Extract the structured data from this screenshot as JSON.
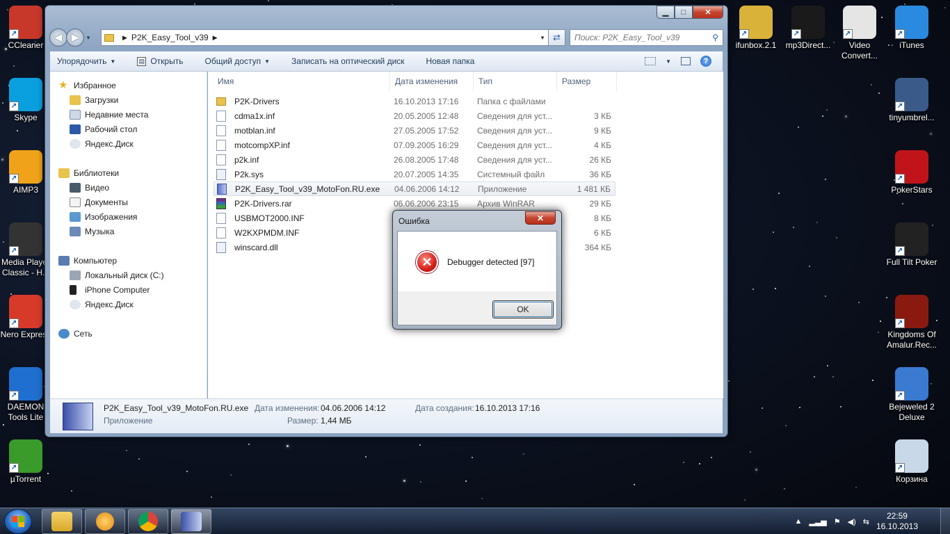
{
  "desktop": {
    "left_icons": [
      {
        "label": "CCleaner",
        "icon": "ccleaner-icon",
        "color": "#c8382a"
      },
      {
        "label": "Skype",
        "icon": "skype-icon",
        "color": "#0aa0e0"
      },
      {
        "label": "AIMP3",
        "icon": "aimp-icon",
        "color": "#f0a21a"
      },
      {
        "label": "Media Player Classic - H...",
        "icon": "media-player-classic-icon",
        "color": "#333333"
      },
      {
        "label": "Nero Express",
        "icon": "nero-icon",
        "color": "#d83a2a"
      },
      {
        "label": "DAEMON Tools Lite",
        "icon": "daemon-tools-icon",
        "color": "#1f6fd0"
      },
      {
        "label": "µTorrent",
        "icon": "utorrent-icon",
        "color": "#3a9a2a"
      }
    ],
    "top_icons": [
      {
        "label": "ifunbox.2.1",
        "icon": "archive-folder-icon",
        "color": "#d9b23a"
      },
      {
        "label": "mp3Direct...",
        "icon": "mp3directcut-icon",
        "color": "#1a1a1a"
      },
      {
        "label": "Video Convert...",
        "icon": "video-converter-icon",
        "color": "#e5e5e5"
      },
      {
        "label": "iTunes",
        "icon": "itunes-icon",
        "color": "#2a8ae0"
      }
    ],
    "right_icons": [
      {
        "label": "tinyumbrel...",
        "icon": "tinyumbrella-icon",
        "color": "#3a5a8a"
      },
      {
        "label": "PokerStars",
        "icon": "pokerstars-icon",
        "color": "#c0141a"
      },
      {
        "label": "Full Tilt Poker",
        "icon": "full-tilt-poker-icon",
        "color": "#222222"
      },
      {
        "label": "Kingdoms Of Amalur.Rec...",
        "icon": "kingdoms-of-amalur-icon",
        "color": "#8a1a10"
      },
      {
        "label": "Bejeweled 2 Deluxe",
        "icon": "bejeweled-icon",
        "color": "#3a7ad0"
      },
      {
        "label": "Корзина",
        "icon": "recycle-bin-icon",
        "color": "#c8d8e8"
      }
    ]
  },
  "explorer": {
    "path": "P2K_Easy_Tool_v39",
    "search_placeholder": "Поиск: P2K_Easy_Tool_v39",
    "toolbar": {
      "organize": "Упорядочить",
      "open": "Открыть",
      "share": "Общий доступ",
      "burn": "Записать на оптический диск",
      "new_folder": "Новая папка"
    },
    "nav": {
      "favorites": "Избранное",
      "downloads": "Загрузки",
      "recent": "Недавние места",
      "desktop": "Рабочий стол",
      "yandex_disk": "Яндекс.Диск",
      "libraries": "Библиотеки",
      "video": "Видео",
      "documents": "Документы",
      "images": "Изображения",
      "music": "Музыка",
      "computer": "Компьютер",
      "local_disk": "Локальный диск (C:)",
      "iphone": "iPhone Computer",
      "yandex_disk2": "Яндекс.Диск",
      "network": "Сеть"
    },
    "columns": {
      "name": "Имя",
      "date": "Дата изменения",
      "type": "Тип",
      "size": "Размер"
    },
    "files": [
      {
        "name": "P2K-Drivers",
        "date": "16.10.2013 17:16",
        "type": "Папка с файлами",
        "size": "",
        "kind": "folder"
      },
      {
        "name": "cdma1x.inf",
        "date": "20.05.2005 12:48",
        "type": "Сведения для уст...",
        "size": "3 КБ",
        "kind": "doc"
      },
      {
        "name": "motblan.inf",
        "date": "27.05.2005 17:52",
        "type": "Сведения для уст...",
        "size": "9 КБ",
        "kind": "doc"
      },
      {
        "name": "motcompXP.inf",
        "date": "07.09.2005 16:29",
        "type": "Сведения для уст...",
        "size": "4 КБ",
        "kind": "doc"
      },
      {
        "name": "p2k.inf",
        "date": "26.08.2005 17:48",
        "type": "Сведения для уст...",
        "size": "26 КБ",
        "kind": "doc"
      },
      {
        "name": "P2k.sys",
        "date": "20.07.2005 14:35",
        "type": "Системный файл",
        "size": "36 КБ",
        "kind": "sys"
      },
      {
        "name": "P2K_Easy_Tool_v39_MotoFon.RU.exe",
        "date": "04.06.2006 14:12",
        "type": "Приложение",
        "size": "1 481 КБ",
        "kind": "exe"
      },
      {
        "name": "P2K-Drivers.rar",
        "date": "06.06.2006 23:15",
        "type": "Архив WinRAR",
        "size": "29 КБ",
        "kind": "rar"
      },
      {
        "name": "USBMOT2000.INF",
        "date": "",
        "type": "",
        "size": "8 КБ",
        "kind": "doc"
      },
      {
        "name": "W2KXPMDM.INF",
        "date": "",
        "type": "",
        "size": "6 КБ",
        "kind": "doc"
      },
      {
        "name": "winscard.dll",
        "date": "",
        "type": "",
        "size": "364 КБ",
        "kind": "sys"
      }
    ],
    "status": {
      "filename": "P2K_Easy_Tool_v39_MotoFon.RU.exe",
      "filetype": "Приложение",
      "modified_label": "Дата изменения:",
      "modified_value": "04.06.2006 14:12",
      "created_label": "Дата создания:",
      "created_value": "16.10.2013 17:16",
      "size_label": "Размер:",
      "size_value": "1,44 МБ"
    }
  },
  "dialog": {
    "title": "Ошибка",
    "message": "Debugger detected [97]",
    "ok": "OK"
  },
  "taskbar": {
    "time": "22:59",
    "date": "16.10.2013"
  }
}
